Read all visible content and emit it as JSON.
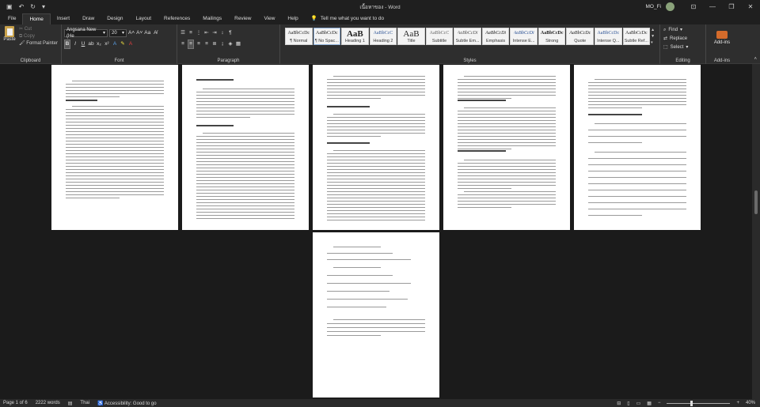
{
  "window": {
    "title": "เนื้อหาของ  -  Word",
    "user": "MO_Fi"
  },
  "tabs": [
    "File",
    "Home",
    "Insert",
    "Draw",
    "Design",
    "Layout",
    "References",
    "Mailings",
    "Review",
    "View",
    "Help"
  ],
  "tell_me": "Tell me what you want to do",
  "clipboard": {
    "paste": "Paste",
    "cut": "Cut",
    "copy": "Copy",
    "format_painter": "Format Painter",
    "label": "Clipboard"
  },
  "font": {
    "name": "Angsana New (He",
    "size": "20",
    "label": "Font"
  },
  "paragraph": {
    "label": "Paragraph"
  },
  "styles": {
    "label": "Styles",
    "items": [
      {
        "sample": "AaBbCcDc",
        "name": "¶ Normal"
      },
      {
        "sample": "AaBbCcDc",
        "name": "¶ No Spac..."
      },
      {
        "sample": "AaB",
        "name": "Heading 1"
      },
      {
        "sample": "AaBbCcC",
        "name": "Heading 2"
      },
      {
        "sample": "AaB",
        "name": "Title"
      },
      {
        "sample": "AaBbCcC",
        "name": "Subtitle"
      },
      {
        "sample": "AaBbCcDi",
        "name": "Subtle Em..."
      },
      {
        "sample": "AaBbCcDi",
        "name": "Emphasis"
      },
      {
        "sample": "AaBbCcDi",
        "name": "Intense E..."
      },
      {
        "sample": "AaBbCcDc",
        "name": "Strong"
      },
      {
        "sample": "AaBbCcDc",
        "name": "Quote"
      },
      {
        "sample": "AaBbCcDc",
        "name": "Intense Q..."
      },
      {
        "sample": "AaBbCcDc",
        "name": "Subtle Ref..."
      }
    ]
  },
  "editing": {
    "find": "Find",
    "replace": "Replace",
    "select": "Select",
    "label": "Editing"
  },
  "addins": {
    "label": "Add-ins",
    "button": "Add-ins"
  },
  "status": {
    "page": "Page 1 of 6",
    "words": "2222 words",
    "language": "Thai",
    "accessibility": "Accessibility: Good to go",
    "zoom": "40%"
  }
}
